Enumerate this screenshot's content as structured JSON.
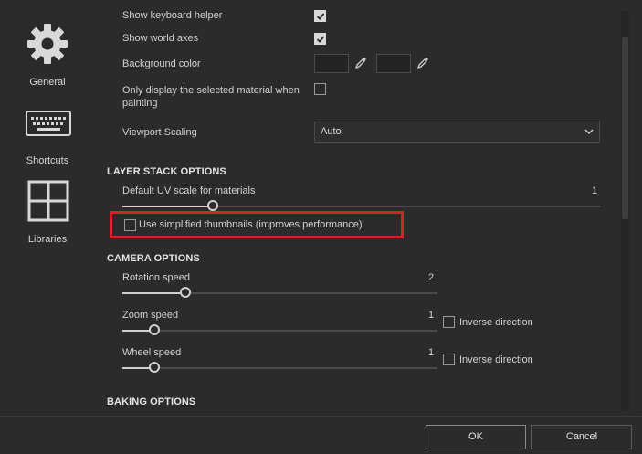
{
  "sidebar": {
    "items": [
      {
        "label": "General",
        "icon": "gear-icon"
      },
      {
        "label": "Shortcuts",
        "icon": "keyboard-icon"
      },
      {
        "label": "Libraries",
        "icon": "grid-icon"
      }
    ]
  },
  "general": {
    "show_keyboard_helper": {
      "label": "Show keyboard helper",
      "checked": true
    },
    "show_world_axes": {
      "label": "Show world axes",
      "checked": true
    },
    "background_color": {
      "label": "Background color"
    },
    "only_selected_material": {
      "label_line1": "Only display the selected material when",
      "label_line2": "painting",
      "checked": false
    },
    "viewport_scaling": {
      "label": "Viewport Scaling",
      "value": "Auto"
    }
  },
  "layer_stack": {
    "title": "LAYER STACK OPTIONS",
    "uv_scale": {
      "label": "Default UV scale for materials",
      "value": "1",
      "fraction": 0.19
    },
    "simplified_thumbnails": {
      "label": "Use simplified thumbnails (improves performance)",
      "checked": false
    }
  },
  "camera": {
    "title": "CAMERA OPTIONS",
    "rotation": {
      "label": "Rotation speed",
      "value": "2",
      "fraction": 0.2
    },
    "zoom": {
      "label": "Zoom speed",
      "value": "1",
      "fraction": 0.1,
      "inverse_label": "Inverse direction",
      "inverse_checked": false
    },
    "wheel": {
      "label": "Wheel speed",
      "value": "1",
      "fraction": 0.1,
      "inverse_label": "Inverse direction",
      "inverse_checked": false
    }
  },
  "baking": {
    "title": "BAKING OPTIONS"
  },
  "footer": {
    "ok_label": "OK",
    "cancel_label": "Cancel"
  },
  "colors": {
    "highlight": "#d8222a",
    "background": "#2b2b2b"
  }
}
